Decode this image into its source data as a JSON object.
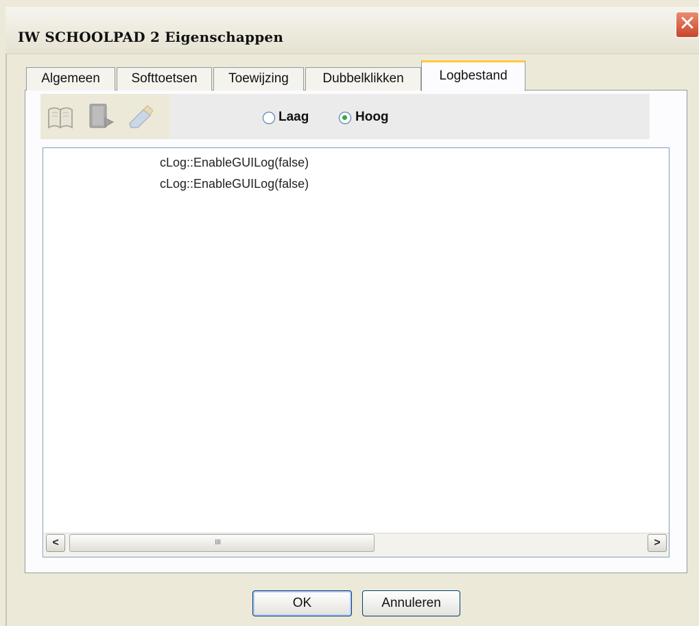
{
  "window": {
    "title": "IW SCHOOLPAD 2 Eigenschappen",
    "close_label": "✕"
  },
  "tabs": [
    {
      "label": "Algemeen",
      "active": false
    },
    {
      "label": "Softtoetsen",
      "active": false
    },
    {
      "label": "Toewijzing",
      "active": false
    },
    {
      "label": "Dubbelklikken",
      "active": false
    },
    {
      "label": "Logbestand",
      "active": true
    }
  ],
  "toolbar": {
    "icons": [
      "book-icon",
      "save-file-icon",
      "eraser-icon"
    ],
    "radio_options": [
      {
        "label": "Laag",
        "selected": false
      },
      {
        "label": "Hoog",
        "selected": true
      }
    ]
  },
  "log": {
    "lines": [
      "cLog::EnableGUILog(false)",
      "cLog::EnableGUILog(false)"
    ]
  },
  "scrollbar": {
    "left_arrow": "<",
    "right_arrow": ">",
    "grip": "IIII"
  },
  "buttons": {
    "ok": "OK",
    "cancel": "Annuleren"
  },
  "colors": {
    "active_tab_accent": "#ffc83c",
    "radio_selected": "#39a83b",
    "close_button": "#c8452a"
  }
}
